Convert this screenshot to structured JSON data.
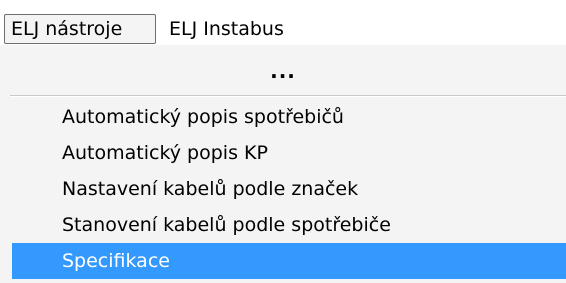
{
  "menubar": {
    "items": [
      {
        "label": "ELJ nástroje",
        "state": "open"
      },
      {
        "label": "ELJ Instabus",
        "state": "normal"
      }
    ]
  },
  "dropdown": {
    "overflow_indicator": "...",
    "items": [
      {
        "label": "Automatický popis spotřebičů",
        "highlighted": false
      },
      {
        "label": "Automatický popis KP",
        "highlighted": false
      },
      {
        "label": "Nastavení kabelů podle značek",
        "highlighted": false
      },
      {
        "label": "Stanovení kabelů podle spotřebiče",
        "highlighted": false
      },
      {
        "label": "Specifikace",
        "highlighted": true
      }
    ]
  },
  "colors": {
    "highlight_background": "#3399ff",
    "highlight_text": "#ffffff",
    "menu_background": "#f4f4f4"
  }
}
